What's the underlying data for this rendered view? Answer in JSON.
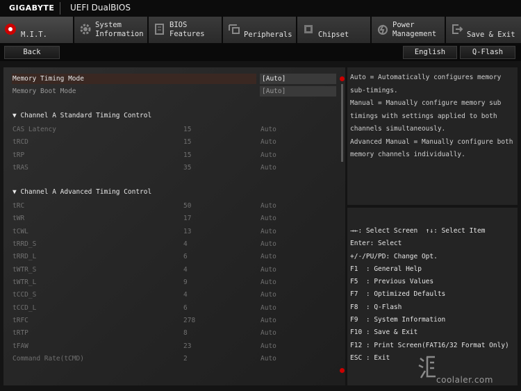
{
  "header": {
    "brand": "GIGABYTE",
    "app_title": "UEFI DualBIOS"
  },
  "tabs": [
    {
      "label": "M.I.T.",
      "icon": "mit-icon",
      "active": true
    },
    {
      "label": "System\nInformation",
      "icon": "gear-icon"
    },
    {
      "label": "BIOS\nFeatures",
      "icon": "bios-chip-icon"
    },
    {
      "label": "Peripherals",
      "icon": "peripherals-icon"
    },
    {
      "label": "Chipset",
      "icon": "chipset-icon"
    },
    {
      "label": "Power\nManagement",
      "icon": "power-icon"
    },
    {
      "label": "Save & Exit",
      "icon": "exit-icon"
    }
  ],
  "buttons": {
    "back": "Back",
    "language": "English",
    "qflash": "Q-Flash"
  },
  "settings": {
    "memory_timing_mode": {
      "label": "Memory Timing Mode",
      "value": "[Auto]"
    },
    "memory_boot_mode": {
      "label": "Memory Boot Mode",
      "value": "[Auto]"
    },
    "std_section": "Channel A Standard Timing Control",
    "std_rows": [
      {
        "name": "CAS Latency",
        "current": "15",
        "value": "Auto"
      },
      {
        "name": "tRCD",
        "current": "15",
        "value": "Auto"
      },
      {
        "name": "tRP",
        "current": "15",
        "value": "Auto"
      },
      {
        "name": "tRAS",
        "current": "35",
        "value": "Auto"
      }
    ],
    "adv_section": "Channel A Advanced Timing Control",
    "adv_rows": [
      {
        "name": "tRC",
        "current": "50",
        "value": "Auto"
      },
      {
        "name": "tWR",
        "current": "17",
        "value": "Auto"
      },
      {
        "name": "tCWL",
        "current": "13",
        "value": "Auto"
      },
      {
        "name": "tRRD_S",
        "current": "4",
        "value": "Auto"
      },
      {
        "name": "tRRD_L",
        "current": "6",
        "value": "Auto"
      },
      {
        "name": "tWTR_S",
        "current": "4",
        "value": "Auto"
      },
      {
        "name": "tWTR_L",
        "current": "9",
        "value": "Auto"
      },
      {
        "name": "tCCD_S",
        "current": "4",
        "value": "Auto"
      },
      {
        "name": "tCCD_L",
        "current": "6",
        "value": "Auto"
      },
      {
        "name": "tRFC",
        "current": "278",
        "value": "Auto"
      },
      {
        "name": "tRTP",
        "current": "8",
        "value": "Auto"
      },
      {
        "name": "tFAW",
        "current": "23",
        "value": "Auto"
      },
      {
        "name": "Command Rate(tCMD)",
        "current": "2",
        "value": "Auto"
      }
    ]
  },
  "help_text": "Auto = Automatically configures memory sub-timings.\nManual = Manually configure memory sub timings with settings applied to both channels simultaneously.\nAdvanced Manual = Manually configure both memory channels individually.",
  "key_help": [
    "→←: Select Screen  ↑↓: Select Item",
    "Enter: Select",
    "+/-/PU/PD: Change Opt.",
    "F1  : General Help",
    "F5  : Previous Values",
    "F7  : Optimized Defaults",
    "F8  : Q-Flash",
    "F9  : System Information",
    "F10 : Save & Exit",
    "F12 : Print Screen(FAT16/32 Format Only)",
    "ESC : Exit"
  ],
  "watermark": "coolaler.com",
  "colors": {
    "accent_red": "#cc0000",
    "highlight_row": "#3a2822"
  }
}
